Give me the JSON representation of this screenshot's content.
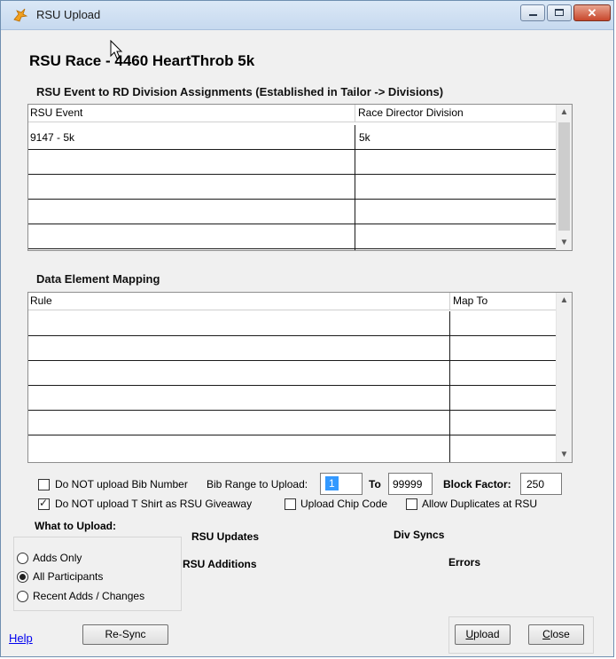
{
  "window": {
    "title": "RSU Upload",
    "close_glyph": "✕"
  },
  "race_title": "RSU Race - 4460 HeartThrob 5k",
  "assignments": {
    "section_label": "RSU Event to RD Division Assignments (Established in Tailor -> Divisions)",
    "columns": [
      "RSU Event",
      "Race Director Division"
    ],
    "rows": [
      {
        "event": "9147 - 5k",
        "division": "5k"
      },
      {
        "event": "",
        "division": ""
      },
      {
        "event": "",
        "division": ""
      },
      {
        "event": "",
        "division": ""
      },
      {
        "event": "",
        "division": ""
      }
    ]
  },
  "mapping": {
    "section_label": "Data Element Mapping",
    "columns": [
      "Rule",
      "Map To"
    ]
  },
  "options": {
    "no_bib_label": "Do NOT upload Bib Number",
    "no_bib_checked": false,
    "bib_range_label": "Bib Range to Upload:",
    "bib_from": "1",
    "to_label": "To",
    "bib_to": "99999",
    "block_factor_label": "Block Factor:",
    "block_factor": "250",
    "no_tshirt_label": "Do NOT upload T Shirt as RSU Giveaway",
    "no_tshirt_checked": true,
    "chip_code_label": "Upload Chip Code",
    "chip_code_checked": false,
    "allow_dupes_label": "Allow Duplicates at RSU",
    "allow_dupes_checked": false
  },
  "what_to_upload": {
    "label": "What to Upload:",
    "choices": [
      {
        "label": "Adds Only",
        "selected": false
      },
      {
        "label": "All Participants",
        "selected": true
      },
      {
        "label": "Recent Adds / Changes",
        "selected": false
      }
    ]
  },
  "status": {
    "rsu_updates": "RSU Updates",
    "rsu_additions": "RSU Additions",
    "div_syncs": "Div Syncs",
    "errors": "Errors"
  },
  "buttons": {
    "help": "Help",
    "resync": "Re-Sync",
    "upload_u": "U",
    "upload_rest": "pload",
    "close_u": "C",
    "close_rest": "lose"
  },
  "icons": {
    "app": "runner-app-icon",
    "scroll_up": "▲",
    "scroll_down": "▼"
  }
}
